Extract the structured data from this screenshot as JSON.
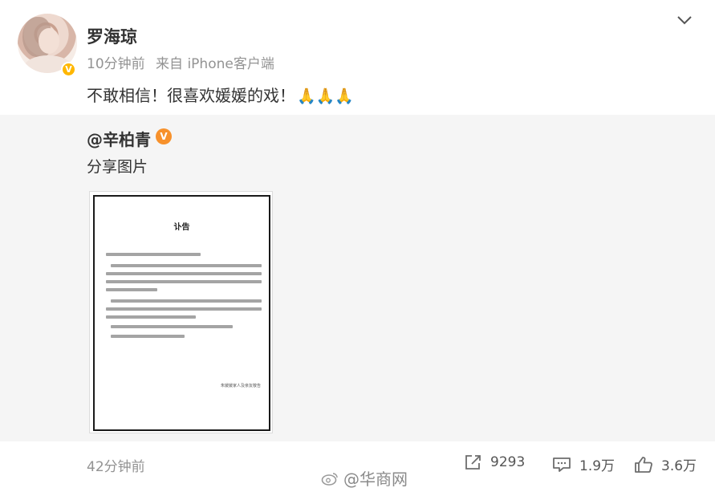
{
  "post": {
    "author_name": "罗海琼",
    "verified_badge": "V",
    "time": "10分钟前",
    "source": "来自 iPhone客户端",
    "text": "不敢相信！很喜欢媛媛的戏！",
    "emoji": "🙏🙏🙏",
    "avatar_icon": "user-avatar",
    "more_icon": "chevron-down-icon"
  },
  "repost": {
    "author_name": "@辛柏青",
    "verified_badge": "V",
    "text": "分享图片",
    "image": {
      "title": "讣告",
      "signature": "朱媛媛家人及亲友敬告"
    }
  },
  "footer": {
    "time": "42分钟前",
    "repost_count": "9293",
    "comment_count": "1.9万",
    "like_count": "3.6万",
    "watermark": "@华商网"
  },
  "colors": {
    "gray_text": "#939393",
    "repost_bg": "#f5f5f5",
    "badge_yellow": "#ffb700",
    "badge_orange": "#f7912b"
  }
}
